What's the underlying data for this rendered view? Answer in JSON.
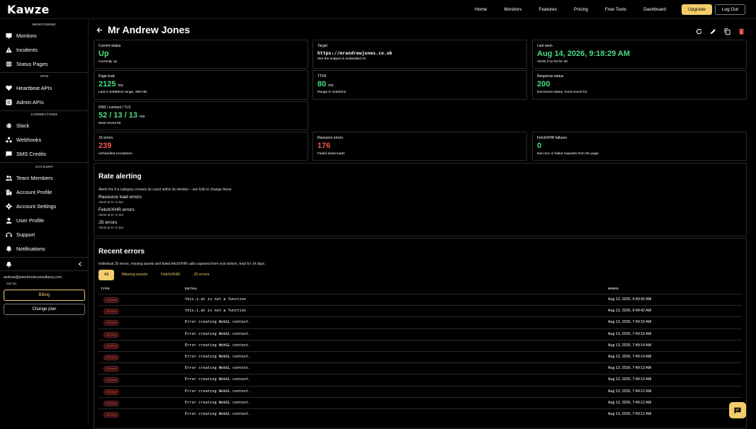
{
  "app": {
    "logo": "Kawze"
  },
  "topnav": {
    "links": [
      "Home",
      "Monitors",
      "Features",
      "Pricing",
      "Free Tools",
      "Dashboard"
    ],
    "upgrade": "Upgrade",
    "logout": "Log Out",
    "accent": "#f2cd6a"
  },
  "sidebar": {
    "sections": {
      "monitoring": "MONITORING",
      "apis": "APIS",
      "connections": "CONNECTIONS",
      "account": "ACCOUNT"
    },
    "items": {
      "monitors": "Monitors",
      "incidents": "Incidents",
      "status_pages": "Status Pages",
      "heartbeat": "Heartbeat APIs",
      "admin": "Admin APIs",
      "slack": "Slack",
      "webhooks": "Webhooks",
      "sms": "SMS Credits",
      "team": "Team Members",
      "account_profile": "Account Profile",
      "account_settings": "Account Settings",
      "user_profile": "User Profile",
      "support": "Support",
      "notifications": "Notifications"
    },
    "email": "andrew@peterbrookconsultancy.com",
    "tier": "Mid tier",
    "billing": "Billing",
    "change_plan": "Change plan"
  },
  "page": {
    "title": "Mr Andrew Jones"
  },
  "cards": {
    "status": {
      "label": "Current status",
      "value": "Up",
      "sub": "Currently up"
    },
    "target": {
      "label": "Target",
      "value": "https://mrandrewjones.co.uk",
      "sub": "Site the snippet is embedded on"
    },
    "last_seen": {
      "label": "Last seen",
      "value": "Aug 14, 2026, 9:18:29 AM",
      "sub": "Alerts if no hit for 3d"
    },
    "page_load": {
      "label": "Page load",
      "value": "2125",
      "unit": "ms",
      "sub": "Last 0–54069ms range, 498 hits"
    },
    "ttfb": {
      "label": "TTFB",
      "value": "80",
      "unit": "ms",
      "sub": "Range 0–11583ms"
    },
    "response": {
      "label": "Response status",
      "value": "200",
      "sub": "Document status, most recent hit"
    },
    "dns": {
      "label": "DNS / connect / TLS",
      "value": "52 / 13 / 13",
      "unit": "ms",
      "sub": "Most recent hit"
    },
    "js_errors": {
      "label": "JS errors",
      "value": "239",
      "sub": "Unhandled exceptions"
    },
    "resource_errors": {
      "label": "Resource errors",
      "value": "176",
      "sub": "Failed asset loads"
    },
    "fetch_failures": {
      "label": "Fetch/XHR failures",
      "value": "0",
      "sub": "Non-2xx or failed requests from the page"
    }
  },
  "rate_alerting": {
    "title": "Rate alerting",
    "intro": "Alerts fire if a category crosses its count within its window – see Edit to change these.",
    "rules": [
      {
        "name": "Resource load errors",
        "sub": "Alerts at 5+ in 5m"
      },
      {
        "name": "Fetch/XHR errors",
        "sub": "Alerts at 5+ in 5m"
      },
      {
        "name": "JS errors",
        "sub": "Alerts at 5+ in 5m"
      }
    ]
  },
  "recent_errors": {
    "title": "Recent errors",
    "intro": "Individual JS errors, missing assets and failed fetch/XHR calls captured from real visitors, kept for 14 days.",
    "filters": [
      "All",
      "Missing assets",
      "Fetch/XHR",
      "JS errors"
    ],
    "columns": {
      "type": "TYPE",
      "detail": "DETAIL",
      "when": "WHEN"
    },
    "rows": [
      {
        "type": "JS error",
        "detail": "this.i.at is not a function",
        "when": "Aug 13, 2026, 9:49:42 AM"
      },
      {
        "type": "JS error",
        "detail": "this.i.at is not a function",
        "when": "Aug 13, 2026, 9:49:42 AM"
      },
      {
        "type": "JS error",
        "detail": "Error creating WebGL context.",
        "when": "Aug 13, 2026, 7:49:15 AM"
      },
      {
        "type": "JS error",
        "detail": "Error creating WebGL context.",
        "when": "Aug 13, 2026, 7:49:15 AM"
      },
      {
        "type": "JS error",
        "detail": "Error creating WebGL context.",
        "when": "Aug 13, 2026, 7:49:14 AM"
      },
      {
        "type": "JS error",
        "detail": "Error creating WebGL context.",
        "when": "Aug 13, 2026, 7:49:14 AM"
      },
      {
        "type": "JS error",
        "detail": "Error creating WebGL context.",
        "when": "Aug 13, 2026, 7:49:13 AM"
      },
      {
        "type": "JS error",
        "detail": "Error creating WebGL context.",
        "when": "Aug 13, 2026, 7:49:13 AM"
      },
      {
        "type": "JS error",
        "detail": "Error creating WebGL context.",
        "when": "Aug 13, 2026, 7:49:12 AM"
      },
      {
        "type": "JS error",
        "detail": "Error creating WebGL context.",
        "when": "Aug 13, 2026, 7:49:12 AM"
      },
      {
        "type": "JS error",
        "detail": "Error creating WebGL context.",
        "when": "Aug 13, 2026, 7:49:12 AM"
      }
    ]
  }
}
